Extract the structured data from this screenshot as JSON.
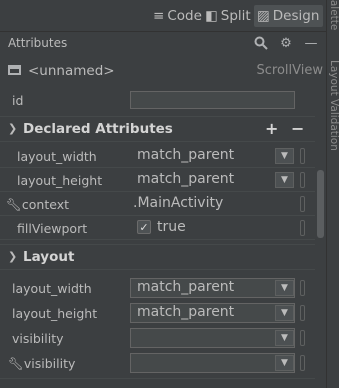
{
  "toolbar": {
    "code_label": "Code",
    "split_label": "Split",
    "design_label": "Design"
  },
  "side_strip": {
    "palette_label": "Palette",
    "layout_validation_label": "Layout Validation"
  },
  "attributes": {
    "title": "Attributes",
    "component_name": "<unnamed>",
    "component_type": "ScrollView",
    "id_label": "id",
    "id_value": ""
  },
  "declared": {
    "title": "Declared Attributes",
    "rows": [
      {
        "label": "layout_width",
        "value": "match_parent"
      },
      {
        "label": "layout_height",
        "value": "match_parent"
      },
      {
        "label": "context",
        "value": ".MainActivity"
      },
      {
        "label": "fillViewport",
        "value": "true",
        "checked": true
      }
    ]
  },
  "layout": {
    "title": "Layout",
    "rows": [
      {
        "label": "layout_width",
        "value": "match_parent"
      },
      {
        "label": "layout_height",
        "value": "match_parent"
      },
      {
        "label": "visibility",
        "value": ""
      },
      {
        "label": "visibility",
        "value": ""
      }
    ]
  }
}
